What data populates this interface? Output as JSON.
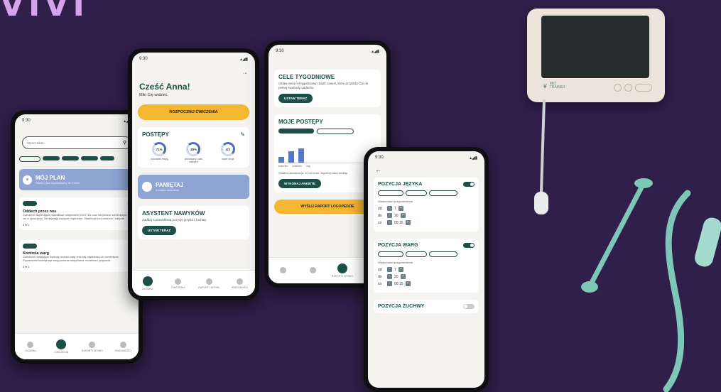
{
  "brand": "VIVI",
  "status_time": "9:30",
  "phone1": {
    "search_placeholder": "Wpisz tekst...",
    "chips": [
      "",
      "",
      "",
      "",
      ""
    ],
    "plan_title": "MÓJ PLAN",
    "plan_sub": "Stwórz plan dopasowany do Ciebie",
    "card1": {
      "tag": "",
      "title": "Oddech przez nos",
      "desc": "Ćwiczenie wspierające prawidłowe oddychanie przez nos oraz utrzymanie zamkniętych ust w spoczynku. Zmniejszają napięcie mięśniowe. Stabilizuje tory oddechu i odżycia.",
      "stats": "3 ● 1"
    },
    "card2": {
      "tag": "",
      "title": "Kontrola warg",
      "desc": "Ćwiczenie rozwijające kontrolę ruchów warg oraz siłę mięśniową ich domknięcia. Poprawienie koordynacji warg podczas oddychania, mówienia i połykania.",
      "stats": "3 ● 1"
    },
    "nav": [
      "GŁÓWNA",
      "ĆWICZENIA",
      "RAPORT I WYNIKI",
      "WIADOMOŚCI"
    ]
  },
  "phone2": {
    "greeting": "Cześć Anna!",
    "greeting_sub": "Miło Cię widzieć.",
    "start_button": "ROZPOCZNIJ ĆWICZENIA",
    "progress_title": "POSTĘPY",
    "rings": [
      {
        "value": "71%",
        "label": "pozostałe etapy"
      },
      {
        "value": "38%",
        "label": "planowany czas ćwiczeń"
      },
      {
        "value": "4/3",
        "label": "nowe sesje"
      }
    ],
    "remember_title": "PAMIĘTAJ",
    "remember_sub": "o czasie ćwiczenia",
    "assistant_title": "ASYSTENT NAWYKÓW",
    "assistant_desc": "Zadbaj o prawidłową pozycję języka i żuchwy.",
    "assistant_button": "USTAW TERAZ",
    "nav": [
      "GŁÓWNA",
      "ĆWICZENIA",
      "RAPORT I WYNIKI",
      "WIADOMOŚCI"
    ]
  },
  "phone3": {
    "goals_title": "CELE TYGODNIOWE",
    "goals_desc": "Ustaw swój cel tygodniowy i bądź nowoś, który przybliży Cię do pełnej swobody oddechu.",
    "goals_button": "USTAW TERAZ",
    "progress_title": "MOJE POSTĘPY",
    "tabs": [
      "",
      ""
    ],
    "bar_labels": [
      "kwiecień",
      "kwiecień",
      "maj"
    ],
    "update_text": "Ostatnia aktualizacja: 20 dni temu. Wypełnij nową ankietę.",
    "survey_button": "WYKONAJ ANKIETĘ",
    "report_button": "WYŚLIJ RAPORT LOGOPEDZIE",
    "nav": [
      "",
      "",
      "RAPORT I WYNIKI",
      ""
    ]
  },
  "phone4": {
    "sections": [
      {
        "title": "POZYCJA JĘZYKA",
        "on": true,
        "chips": [
          "",
          "",
          ""
        ],
        "sub": "Wiadomości przypomnienia",
        "rows": [
          {
            "k": "od",
            "v": "7"
          },
          {
            "k": "do",
            "v": "20"
          },
          {
            "k": "co",
            "v": "00:15"
          }
        ]
      },
      {
        "title": "POZYCJA WARG",
        "on": true,
        "chips": [
          "",
          "",
          ""
        ],
        "sub": "Wiadomości przypomnienia",
        "rows": [
          {
            "k": "od",
            "v": "7"
          },
          {
            "k": "do",
            "v": "20"
          },
          {
            "k": "co",
            "v": "00:15"
          }
        ]
      },
      {
        "title": "POZYCJA ŻUCHWY",
        "on": false
      }
    ]
  },
  "device": {
    "logo_line1": "MIO",
    "logo_line2": "TRAINER"
  }
}
